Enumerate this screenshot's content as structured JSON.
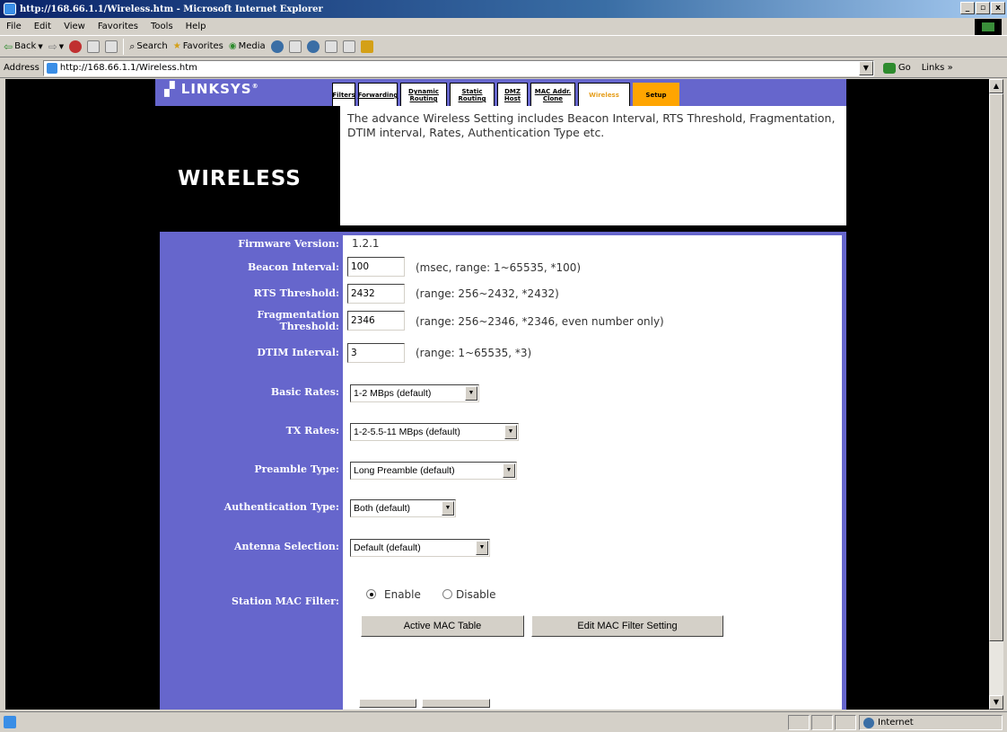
{
  "window": {
    "title": "http://168.66.1.1/Wireless.htm - Microsoft Internet Explorer",
    "buttons": [
      "_",
      "▫",
      "x"
    ]
  },
  "menu": [
    "File",
    "Edit",
    "View",
    "Favorites",
    "Tools",
    "Help"
  ],
  "toolbar": {
    "back": "Back",
    "search": "Search",
    "favorites": "Favorites",
    "media": "Media"
  },
  "address": {
    "label": "Address",
    "url": "http://168.66.1.1/Wireless.htm",
    "go": "Go",
    "links": "Links »"
  },
  "brand": {
    "logo": "LINKSYS"
  },
  "tabs": [
    {
      "label": "Filters"
    },
    {
      "label": "Forwarding"
    },
    {
      "label": "Dynamic Routing"
    },
    {
      "label": "Static Routing"
    },
    {
      "label": "DMZ Host"
    },
    {
      "label": "MAC Addr. Clone"
    },
    {
      "label": "Wireless"
    },
    {
      "label": "Setup"
    }
  ],
  "page": {
    "title": "WIRELESS",
    "description": "The advance Wireless Setting includes Beacon Interval, RTS Threshold, Fragmentation, DTIM interval, Rates, Authentication Type etc."
  },
  "form": {
    "firmware": {
      "label": "Firmware Version:",
      "value": "1.2.1"
    },
    "beacon": {
      "label": "Beacon Interval:",
      "value": "100",
      "hint": "(msec, range: 1~65535, *100)"
    },
    "rts": {
      "label": "RTS Threshold:",
      "value": "2432",
      "hint": "(range: 256~2432, *2432)"
    },
    "frag": {
      "label_line1": "Fragmentation",
      "label_line2": "Threshold:",
      "value": "2346",
      "hint": "(range: 256~2346, *2346, even number only)"
    },
    "dtim": {
      "label": "DTIM Interval:",
      "value": "3",
      "hint": "(range: 1~65535, *3)"
    },
    "basic_rates": {
      "label": "Basic Rates:",
      "value": "1-2 MBps (default)"
    },
    "tx_rates": {
      "label": "TX Rates:",
      "value": "1-2-5.5-11 MBps (default)"
    },
    "preamble": {
      "label": "Preamble Type:",
      "value": "Long Preamble (default)"
    },
    "auth": {
      "label": "Authentication Type:",
      "value": "Both (default)"
    },
    "antenna": {
      "label": "Antenna Selection:",
      "value": "Default (default)"
    },
    "mac_filter": {
      "label": "Station MAC Filter:",
      "enable": "Enable",
      "disable": "Disable"
    },
    "buttons": {
      "active_mac": "Active MAC Table",
      "edit_mac": "Edit MAC Filter Setting"
    }
  },
  "status": {
    "zone": "Internet"
  }
}
